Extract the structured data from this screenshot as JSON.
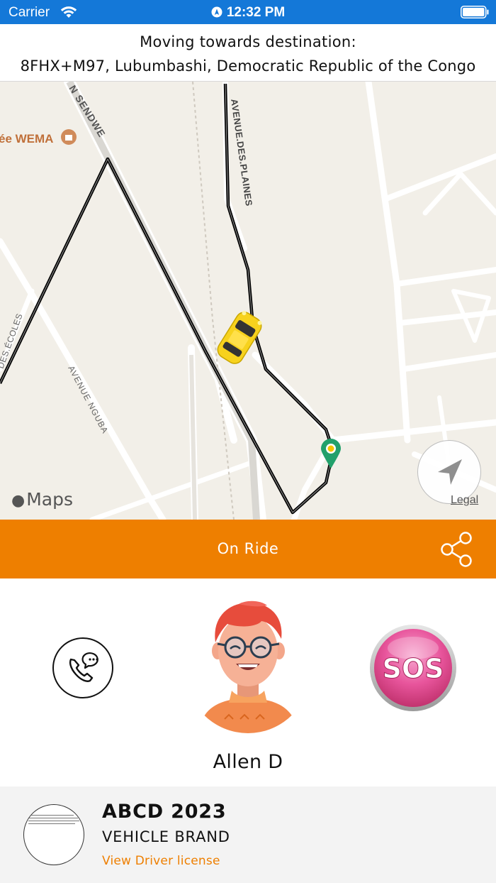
{
  "status_bar": {
    "carrier": "Carrier",
    "time": "12:32 PM",
    "icons": [
      "wifi-icon",
      "location-arrow-icon",
      "battery-icon"
    ]
  },
  "destination": {
    "title": "Moving towards destination:",
    "address": "8FHX+M97, Lubumbashi, Democratic Republic of the Congo"
  },
  "map": {
    "poi_label": "ée WEMA",
    "street_labels": [
      "N SENDWE",
      "AVENUE.DES.PLAINES",
      "AVENUE NGUBA",
      "DES.ÉCOLES"
    ],
    "attribution": "Maps",
    "legal": "Legal",
    "route_color": "#000000",
    "car_color": "#f7d21d",
    "pin_color": "#22a06b"
  },
  "ride": {
    "status": "On Ride",
    "banner_color": "#ee7f00"
  },
  "driver": {
    "name": "Allen D",
    "sos_label": "SOS"
  },
  "vehicle": {
    "plate": "ABCD 2023",
    "brand": "VEHICLE BRAND",
    "license_link": "View Driver license"
  }
}
